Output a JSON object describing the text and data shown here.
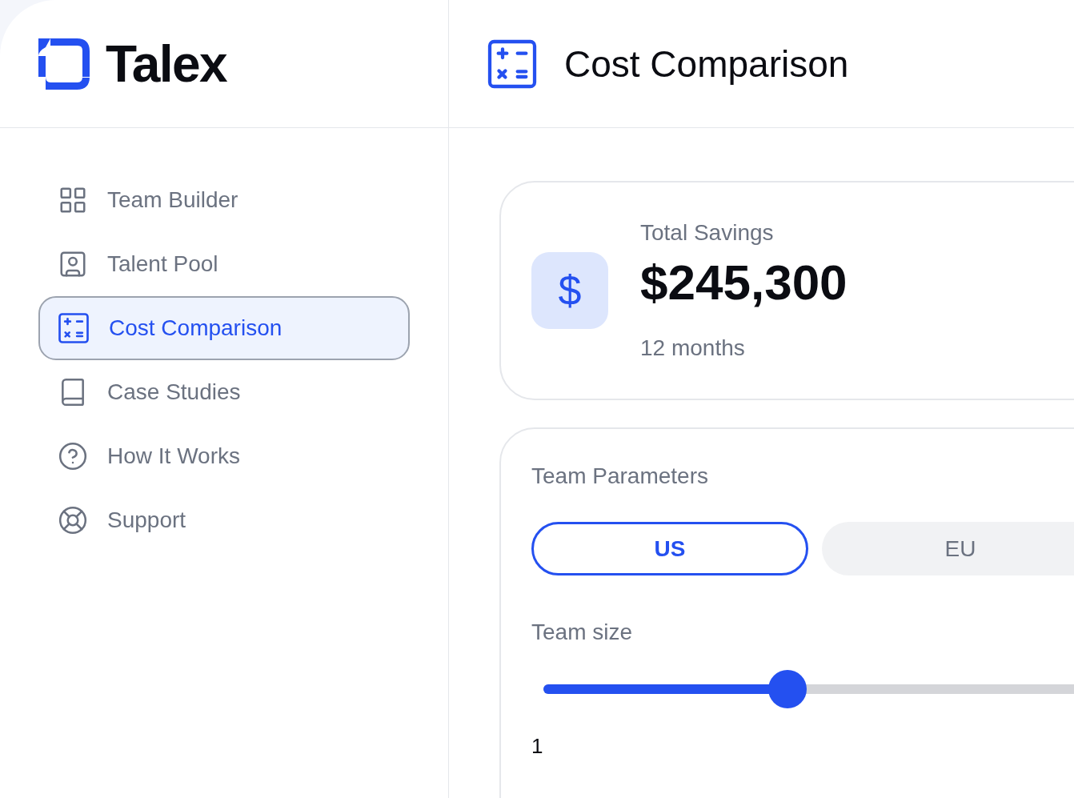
{
  "brand": {
    "name": "Talex"
  },
  "header": {
    "title": "Cost Comparison"
  },
  "nav": [
    {
      "label": "Team Builder",
      "selected": false
    },
    {
      "label": "Talent Pool",
      "selected": false
    },
    {
      "label": "Cost Comparison",
      "selected": true
    },
    {
      "label": "Case Studies",
      "selected": false
    },
    {
      "label": "How It Works",
      "selected": false
    },
    {
      "label": "Support",
      "selected": false
    }
  ],
  "savings": {
    "label": "Total Savings",
    "icon_glyph": "$",
    "value": "$245,300",
    "period": "12 months"
  },
  "parameters": {
    "title": "Team Parameters",
    "regions": [
      {
        "label": "US",
        "selected": true
      },
      {
        "label": "EU",
        "selected": false
      }
    ],
    "team_size": {
      "label": "Team size",
      "level": 0.45,
      "reading": "1"
    }
  }
}
